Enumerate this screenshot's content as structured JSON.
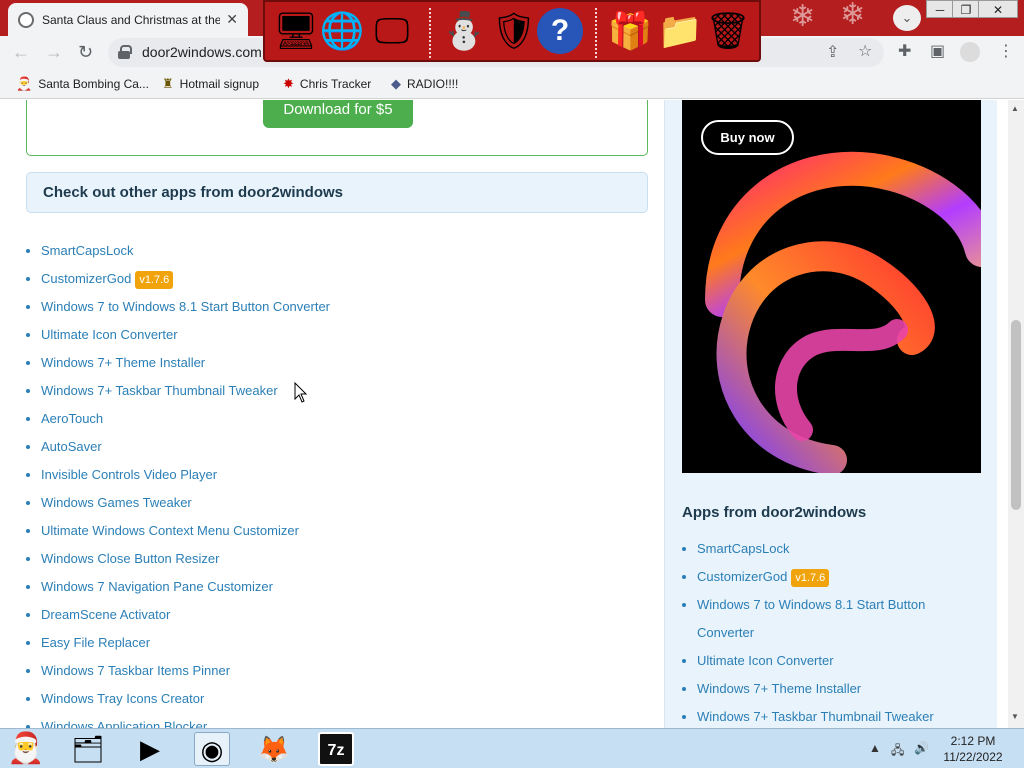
{
  "browser": {
    "tab_title": "Santa Claus and Christmas at the",
    "url": "door2windows.com",
    "bookmarks": [
      {
        "label": "Santa Bombing Ca...",
        "icon": "santa-icon"
      },
      {
        "label": "Hotmail signup",
        "icon": "figure-icon"
      },
      {
        "label": "Chris Tracker",
        "icon": "star-icon"
      },
      {
        "label": "RADIO!!!!",
        "icon": "diamond-icon"
      }
    ]
  },
  "dock": {
    "icons": [
      "computer-santa-icon",
      "globe-icon",
      "monitor-icon",
      "snowman-icon",
      "windows-update-icon",
      "help-icon",
      "gift-icon",
      "folder-icon",
      "recycle-bin-icon"
    ]
  },
  "page": {
    "download_button": "Download for $5",
    "apps_heading": "Check out other apps from door2windows",
    "apps": [
      {
        "label": "SmartCapsLock"
      },
      {
        "label": "CustomizerGod",
        "badge": "v1.7.6"
      },
      {
        "label": "Windows 7 to Windows 8.1 Start Button Converter"
      },
      {
        "label": "Ultimate Icon Converter"
      },
      {
        "label": "Windows 7+ Theme Installer"
      },
      {
        "label": "Windows 7+ Taskbar Thumbnail Tweaker"
      },
      {
        "label": "AeroTouch"
      },
      {
        "label": "AutoSaver"
      },
      {
        "label": "Invisible Controls Video Player"
      },
      {
        "label": "Windows Games Tweaker"
      },
      {
        "label": "Ultimate Windows Context Menu Customizer"
      },
      {
        "label": "Windows Close Button Resizer"
      },
      {
        "label": "Windows 7 Navigation Pane Customizer"
      },
      {
        "label": "DreamScene Activator"
      },
      {
        "label": "Easy File Replacer"
      },
      {
        "label": "Windows 7 Taskbar Items Pinner"
      },
      {
        "label": "Windows Tray Icons Creator"
      },
      {
        "label": "Windows Application Blocker"
      }
    ],
    "sidebar": {
      "ad_button": "Buy now",
      "heading": "Apps from door2windows",
      "apps": [
        {
          "label": "SmartCapsLock"
        },
        {
          "label": "CustomizerGod",
          "badge": "v1.7.6"
        },
        {
          "label": "Windows 7 to Windows 8.1 Start Button Converter"
        },
        {
          "label": "Ultimate Icon Converter"
        },
        {
          "label": "Windows 7+ Theme Installer"
        },
        {
          "label": "Windows 7+ Taskbar Thumbnail Tweaker"
        }
      ]
    }
  },
  "taskbar": {
    "apps": [
      "santa-start-icon",
      "file-manager-icon",
      "media-player-icon",
      "chrome-icon",
      "firefox-icon",
      "7zip-icon"
    ],
    "time": "2:12 PM",
    "date": "11/22/2022"
  }
}
